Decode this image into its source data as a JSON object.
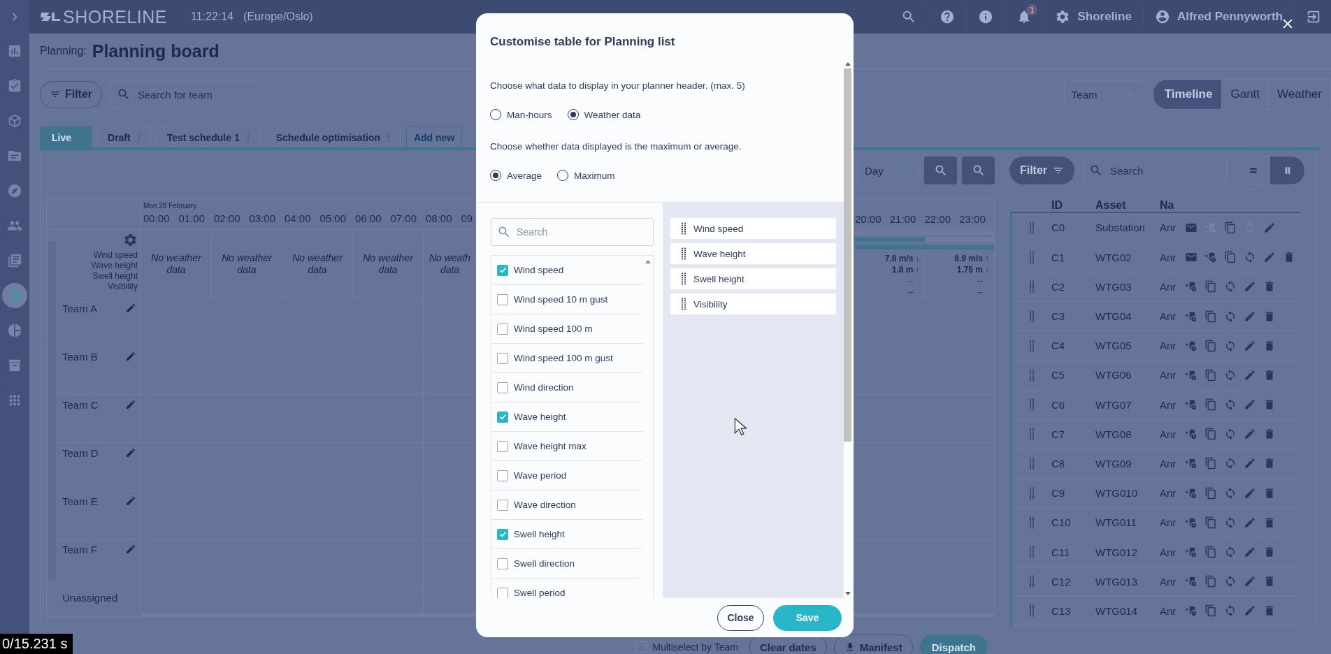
{
  "topbar": {
    "brand": "SHORELINE",
    "time": "11:22:14",
    "timezone": "(Europe/Oslo)",
    "notifications": "1",
    "org": "Shoreline",
    "user": "Alfred Pennyworth"
  },
  "rail": {
    "items": [
      {
        "kind": "chart",
        "selected": false
      },
      {
        "kind": "clipboard",
        "selected": false
      },
      {
        "kind": "cube",
        "selected": false
      },
      {
        "kind": "folder",
        "selected": false
      },
      {
        "kind": "compass",
        "selected": false
      },
      {
        "kind": "people",
        "selected": false
      },
      {
        "kind": "list",
        "selected": false
      },
      {
        "kind": "list",
        "selected": true
      },
      {
        "kind": "pie",
        "selected": false
      },
      {
        "kind": "archive",
        "selected": false
      },
      {
        "kind": "grid",
        "selected": false
      }
    ]
  },
  "header": {
    "section": "Planning:",
    "title": "Planning board"
  },
  "toolbar": {
    "filter": "Filter",
    "search_placeholder": "Search for team",
    "grouping": "Team",
    "views": [
      {
        "label": "Timeline",
        "selected": true
      },
      {
        "label": "Gantt",
        "selected": false
      },
      {
        "label": "Weather",
        "selected": false
      }
    ]
  },
  "schedule_tabs": [
    {
      "label": "Live",
      "selected": true,
      "menu": false
    },
    {
      "label": "Draft",
      "selected": false,
      "menu": true
    },
    {
      "label": "Test schedule 1",
      "selected": false,
      "menu": true
    },
    {
      "label": "Schedule optimisation",
      "selected": false,
      "menu": true
    }
  ],
  "add_tab": "Add new",
  "board": {
    "period": "Day",
    "date": "Mon 28 February",
    "hours_left": [
      "00:00",
      "01:00",
      "02:00",
      "03:00",
      "04:00",
      "05:00",
      "06:00",
      "07:00",
      "08:00",
      "09"
    ],
    "hours_right": [
      "20:00",
      "21:00",
      "22:00",
      "23:00"
    ],
    "weather_fields": [
      "Wind speed",
      "Wave height",
      "Swell height",
      "Visibility"
    ],
    "no_data_cells": [
      "No weather data",
      "No weather data",
      "No weather data",
      "No weather data",
      "No weath data"
    ],
    "readings": [
      {
        "wind": "7.8 m/s",
        "wind_arrow": "↓",
        "wave": "1.8 m",
        "wave_arrow": "↑",
        "swell": "--",
        "visibility": "--"
      },
      {
        "wind": "8.9 m/s",
        "wind_arrow": "↑",
        "wave": "1.75 m",
        "wave_arrow": "↓",
        "swell": "--",
        "visibility": "--"
      }
    ],
    "teams": [
      "Team A",
      "Team B",
      "Team C",
      "Team D",
      "Team E",
      "Team F"
    ],
    "unassigned": "Unassigned"
  },
  "footer": {
    "multiselect": {
      "label": "Multiselect by Team",
      "checked": false
    },
    "clear": "Clear dates",
    "manifest": "Manifest",
    "dispatch": "Dispatch"
  },
  "panel": {
    "filter": "Filter",
    "search_placeholder": "Search",
    "layouts": [
      {
        "kind": "rows",
        "selected": false
      },
      {
        "kind": "columns",
        "selected": true
      }
    ],
    "columns": [
      "ID",
      "Asset",
      "Na"
    ],
    "rows": [
      {
        "id": "C0",
        "asset": "Substation",
        "name": "Anr",
        "actions": [
          {
            "kind": "mail",
            "disabled": false
          },
          {
            "kind": "addtask",
            "disabled": true
          },
          {
            "kind": "copy",
            "disabled": false
          },
          {
            "kind": "sync",
            "disabled": true
          },
          {
            "kind": "edit",
            "disabled": false
          }
        ]
      },
      {
        "id": "C1",
        "asset": "WTG02",
        "name": "Anr",
        "actions": [
          {
            "kind": "mail",
            "disabled": false
          },
          {
            "kind": "addtask",
            "disabled": false
          },
          {
            "kind": "copy",
            "disabled": false
          },
          {
            "kind": "sync",
            "disabled": false
          },
          {
            "kind": "edit",
            "disabled": false
          },
          {
            "kind": "delete",
            "disabled": false
          }
        ]
      },
      {
        "id": "C2",
        "asset": "WTG03",
        "name": "Anr",
        "actions": [
          {
            "kind": "addtask",
            "disabled": false
          },
          {
            "kind": "copy",
            "disabled": false
          },
          {
            "kind": "sync",
            "disabled": false
          },
          {
            "kind": "edit",
            "disabled": false
          },
          {
            "kind": "delete",
            "disabled": false
          }
        ]
      },
      {
        "id": "C3",
        "asset": "WTG04",
        "name": "Anr",
        "actions": [
          {
            "kind": "addtask",
            "disabled": false
          },
          {
            "kind": "copy",
            "disabled": false
          },
          {
            "kind": "sync",
            "disabled": false
          },
          {
            "kind": "edit",
            "disabled": false
          },
          {
            "kind": "delete",
            "disabled": false
          }
        ]
      },
      {
        "id": "C4",
        "asset": "WTG05",
        "name": "Anr",
        "actions": [
          {
            "kind": "addtask",
            "disabled": false
          },
          {
            "kind": "copy",
            "disabled": false
          },
          {
            "kind": "sync",
            "disabled": false
          },
          {
            "kind": "edit",
            "disabled": false
          },
          {
            "kind": "delete",
            "disabled": false
          }
        ]
      },
      {
        "id": "C5",
        "asset": "WTG06",
        "name": "Anr",
        "actions": [
          {
            "kind": "addtask",
            "disabled": false
          },
          {
            "kind": "copy",
            "disabled": false
          },
          {
            "kind": "sync",
            "disabled": false
          },
          {
            "kind": "edit",
            "disabled": false
          },
          {
            "kind": "delete",
            "disabled": false
          }
        ]
      },
      {
        "id": "C6",
        "asset": "WTG07",
        "name": "Anr",
        "actions": [
          {
            "kind": "addtask",
            "disabled": false
          },
          {
            "kind": "copy",
            "disabled": false
          },
          {
            "kind": "sync",
            "disabled": false
          },
          {
            "kind": "edit",
            "disabled": false
          },
          {
            "kind": "delete",
            "disabled": false
          }
        ]
      },
      {
        "id": "C7",
        "asset": "WTG08",
        "name": "Anr",
        "actions": [
          {
            "kind": "addtask",
            "disabled": false
          },
          {
            "kind": "copy",
            "disabled": false
          },
          {
            "kind": "sync",
            "disabled": false
          },
          {
            "kind": "edit",
            "disabled": false
          },
          {
            "kind": "delete",
            "disabled": false
          }
        ]
      },
      {
        "id": "C8",
        "asset": "WTG09",
        "name": "Anr",
        "actions": [
          {
            "kind": "addtask",
            "disabled": false
          },
          {
            "kind": "copy",
            "disabled": false
          },
          {
            "kind": "sync",
            "disabled": false
          },
          {
            "kind": "edit",
            "disabled": false
          },
          {
            "kind": "delete",
            "disabled": false
          }
        ]
      },
      {
        "id": "C9",
        "asset": "WTG010",
        "name": "Anr",
        "actions": [
          {
            "kind": "addtask",
            "disabled": false
          },
          {
            "kind": "copy",
            "disabled": false
          },
          {
            "kind": "sync",
            "disabled": false
          },
          {
            "kind": "edit",
            "disabled": false
          },
          {
            "kind": "delete",
            "disabled": false
          }
        ]
      },
      {
        "id": "C10",
        "asset": "WTG011",
        "name": "Anr",
        "actions": [
          {
            "kind": "addtask",
            "disabled": false
          },
          {
            "kind": "copy",
            "disabled": false
          },
          {
            "kind": "sync",
            "disabled": false
          },
          {
            "kind": "edit",
            "disabled": false
          },
          {
            "kind": "delete",
            "disabled": false
          }
        ]
      },
      {
        "id": "C11",
        "asset": "WTG012",
        "name": "Anr",
        "actions": [
          {
            "kind": "addtask",
            "disabled": false
          },
          {
            "kind": "copy",
            "disabled": false
          },
          {
            "kind": "sync",
            "disabled": false
          },
          {
            "kind": "edit",
            "disabled": false
          },
          {
            "kind": "delete",
            "disabled": false
          }
        ]
      },
      {
        "id": "C12",
        "asset": "WTG013",
        "name": "Anr",
        "actions": [
          {
            "kind": "addtask",
            "disabled": false
          },
          {
            "kind": "copy",
            "disabled": false
          },
          {
            "kind": "sync",
            "disabled": false
          },
          {
            "kind": "edit",
            "disabled": false
          },
          {
            "kind": "delete",
            "disabled": false
          }
        ]
      },
      {
        "id": "C13",
        "asset": "WTG014",
        "name": "Anr",
        "actions": [
          {
            "kind": "addtask",
            "disabled": false
          },
          {
            "kind": "copy",
            "disabled": false
          },
          {
            "kind": "sync",
            "disabled": false
          },
          {
            "kind": "edit",
            "disabled": false
          },
          {
            "kind": "delete",
            "disabled": false
          }
        ]
      }
    ]
  },
  "modal": {
    "title": "Customise table for Planning list",
    "source_prompt": "Choose what data to display in your planner header. (max. 5)",
    "sources": [
      {
        "label": "Man-hours",
        "selected": false
      },
      {
        "label": "Weather data",
        "selected": true
      }
    ],
    "mode_prompt": "Choose whether data displayed is the maximum or average.",
    "modes": [
      {
        "label": "Average",
        "selected": true
      },
      {
        "label": "Maximum",
        "selected": false
      }
    ],
    "search_placeholder": "Search",
    "options": [
      {
        "label": "Wind speed",
        "checked": true
      },
      {
        "label": "Wind speed 10 m gust",
        "checked": false
      },
      {
        "label": "Wind speed 100 m",
        "checked": false
      },
      {
        "label": "Wind speed 100 m gust",
        "checked": false
      },
      {
        "label": "Wind direction",
        "checked": false
      },
      {
        "label": "Wave height",
        "checked": true
      },
      {
        "label": "Wave height max",
        "checked": false
      },
      {
        "label": "Wave period",
        "checked": false
      },
      {
        "label": "Wave direction",
        "checked": false
      },
      {
        "label": "Swell height",
        "checked": true
      },
      {
        "label": "Swell direction",
        "checked": false
      },
      {
        "label": "Swell period",
        "checked": false
      }
    ],
    "chosen": [
      "Wind speed",
      "Wave height",
      "Swell height",
      "Visibility"
    ],
    "close": "Close",
    "save": "Save"
  },
  "player": {
    "time": "0/15.231 s"
  }
}
